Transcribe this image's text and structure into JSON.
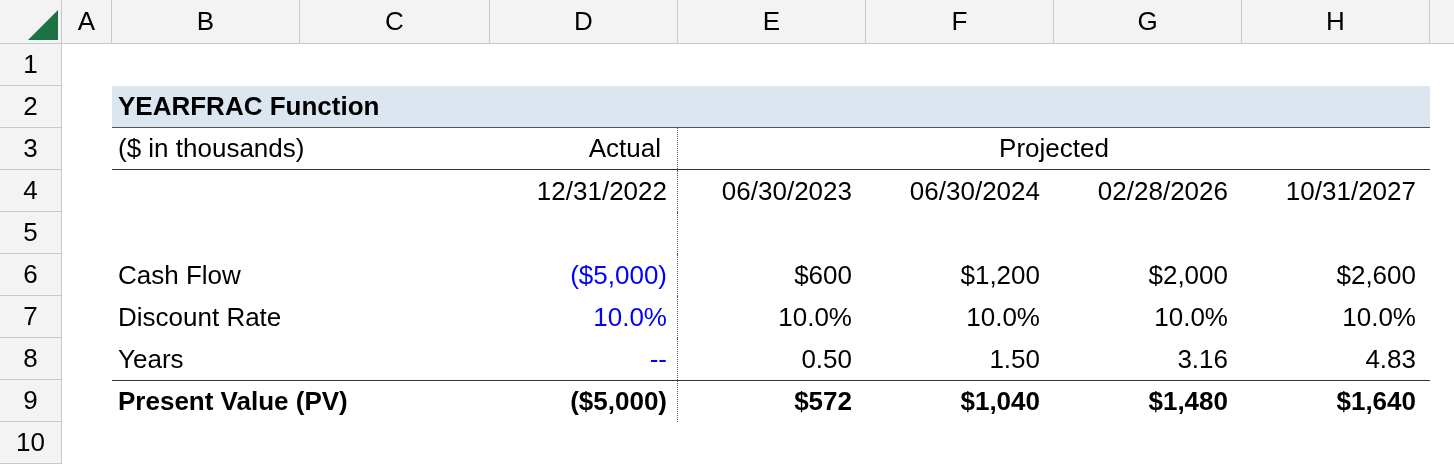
{
  "column_headers": [
    "A",
    "B",
    "C",
    "D",
    "E",
    "F",
    "G",
    "H"
  ],
  "rows": [
    {
      "number": "1"
    },
    {
      "number": "2",
      "kind": "title",
      "label": "YEARFRAC Function"
    },
    {
      "number": "3",
      "kind": "header",
      "label": "($ in thousands)",
      "actual": "Actual",
      "projected": "Projected"
    },
    {
      "number": "4",
      "kind": "dates",
      "actual": "12/31/2022",
      "projected": [
        "06/30/2023",
        "06/30/2024",
        "02/28/2026",
        "10/31/2027"
      ]
    },
    {
      "number": "5",
      "kind": "spacer"
    },
    {
      "number": "6",
      "kind": "data",
      "input": true,
      "label": "Cash Flow",
      "actual": "($5,000)",
      "projected": [
        "$600",
        "$1,200",
        "$2,000",
        "$2,600"
      ]
    },
    {
      "number": "7",
      "kind": "data",
      "input": true,
      "label": "Discount Rate",
      "actual": "10.0%",
      "projected": [
        "10.0%",
        "10.0%",
        "10.0%",
        "10.0%"
      ]
    },
    {
      "number": "8",
      "kind": "data",
      "input": true,
      "label": "Years",
      "actual": "--",
      "projected": [
        "0.50",
        "1.50",
        "3.16",
        "4.83"
      ]
    },
    {
      "number": "9",
      "kind": "total",
      "input": false,
      "label": "Present Value (PV)",
      "actual": "($5,000)",
      "projected": [
        "$572",
        "$1,040",
        "$1,480",
        "$1,640"
      ]
    },
    {
      "number": "10"
    }
  ]
}
